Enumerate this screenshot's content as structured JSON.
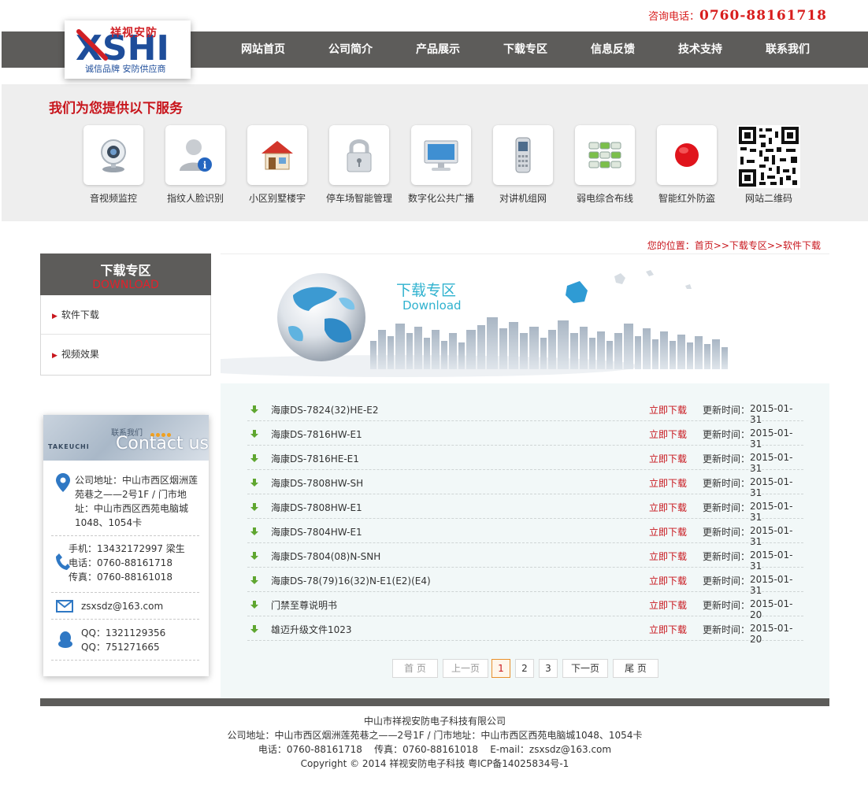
{
  "header": {
    "hotline_label": "咨询电话：",
    "hotline_number": "0760-88161718",
    "logo_text": "XSHI",
    "logo_cn": "祥视安防",
    "logo_slogan": "诚信品牌  安防供应商",
    "nav": [
      "网站首页",
      "公司简介",
      "产品展示",
      "下载专区",
      "信息反馈",
      "技术支持",
      "联系我们"
    ]
  },
  "services": {
    "title": "我们为您提供以下服务",
    "items": [
      {
        "label": "音视频监控",
        "icon": "webcam-icon"
      },
      {
        "label": "指纹人脸识别",
        "icon": "user-info-icon"
      },
      {
        "label": "小区别墅楼宇",
        "icon": "house-icon"
      },
      {
        "label": "停车场智能管理",
        "icon": "padlock-icon"
      },
      {
        "label": "数字化公共广播",
        "icon": "monitor-icon"
      },
      {
        "label": "对讲机组网",
        "icon": "mobile-phone-icon"
      },
      {
        "label": "弱电综合布线",
        "icon": "network-blocks-icon"
      },
      {
        "label": "智能红外防盗",
        "icon": "red-dot-icon"
      },
      {
        "label": "网站二维码",
        "icon": "qr-code-icon"
      }
    ]
  },
  "breadcrumb": "您的位置：首页>>下载专区>>软件下载",
  "sidebar": {
    "title": "下载专区",
    "subtitle": "DOWNLOAD",
    "items": [
      "软件下载",
      "视频效果"
    ]
  },
  "contact": {
    "banner_cn": "联系我们",
    "banner_en": "Contact us",
    "banner_brand": "TAKEUCHI",
    "address": "公司地址：中山市西区烟洲莲苑巷之——2号1F / 门市地址：中山市西区西苑电脑城1048、1054卡",
    "mobile": "手机：13432172997 梁生",
    "phone": "电话：0760-88161718",
    "fax": "传真：0760-88161018",
    "email": "zsxsdz@163.com",
    "qq1": "QQ：1321129356",
    "qq2": "QQ：751271665"
  },
  "banner": {
    "title": "下载专区",
    "subtitle": "Download"
  },
  "downloads": {
    "link_label": "立即下载",
    "date_label": "更新时间：",
    "items": [
      {
        "name": "海康DS-7824(32)HE-E2",
        "date": "2015-01-31"
      },
      {
        "name": "海康DS-7816HW-E1",
        "date": "2015-01-31"
      },
      {
        "name": "海康DS-7816HE-E1",
        "date": "2015-01-31"
      },
      {
        "name": "海康DS-7808HW-SH",
        "date": "2015-01-31"
      },
      {
        "name": "海康DS-7808HW-E1",
        "date": "2015-01-31"
      },
      {
        "name": "海康DS-7804HW-E1",
        "date": "2015-01-31"
      },
      {
        "name": "海康DS-7804(08)N-SNH",
        "date": "2015-01-31"
      },
      {
        "name": "海康DS-78(79)16(32)N-E1(E2)(E4)",
        "date": "2015-01-31"
      },
      {
        "name": "门禁至尊说明书",
        "date": "2015-01-20"
      },
      {
        "name": "雄迈升级文件1023",
        "date": "2015-01-20"
      }
    ]
  },
  "pager": {
    "first": "首 页",
    "prev": "上一页",
    "pages": [
      "1",
      "2",
      "3"
    ],
    "next": "下一页",
    "last": "尾 页",
    "current": "1"
  },
  "footer": {
    "company": "中山市祥视安防电子科技有限公司",
    "address": "公司地址：中山市西区烟洲莲苑巷之——2号1F / 门市地址：中山市西区西苑电脑城1048、1054卡",
    "contacts": "电话：0760-88161718    传真：0760-88161018    E-mail：zsxsdz@163.com",
    "copyright": "Copyright © 2014 祥视安防电子科技  粤ICP备14025834号-1"
  },
  "colors": {
    "accent_red": "#c8161d",
    "nav_gray": "#5d5c5a",
    "banner_cyan": "#2fb2cf"
  }
}
